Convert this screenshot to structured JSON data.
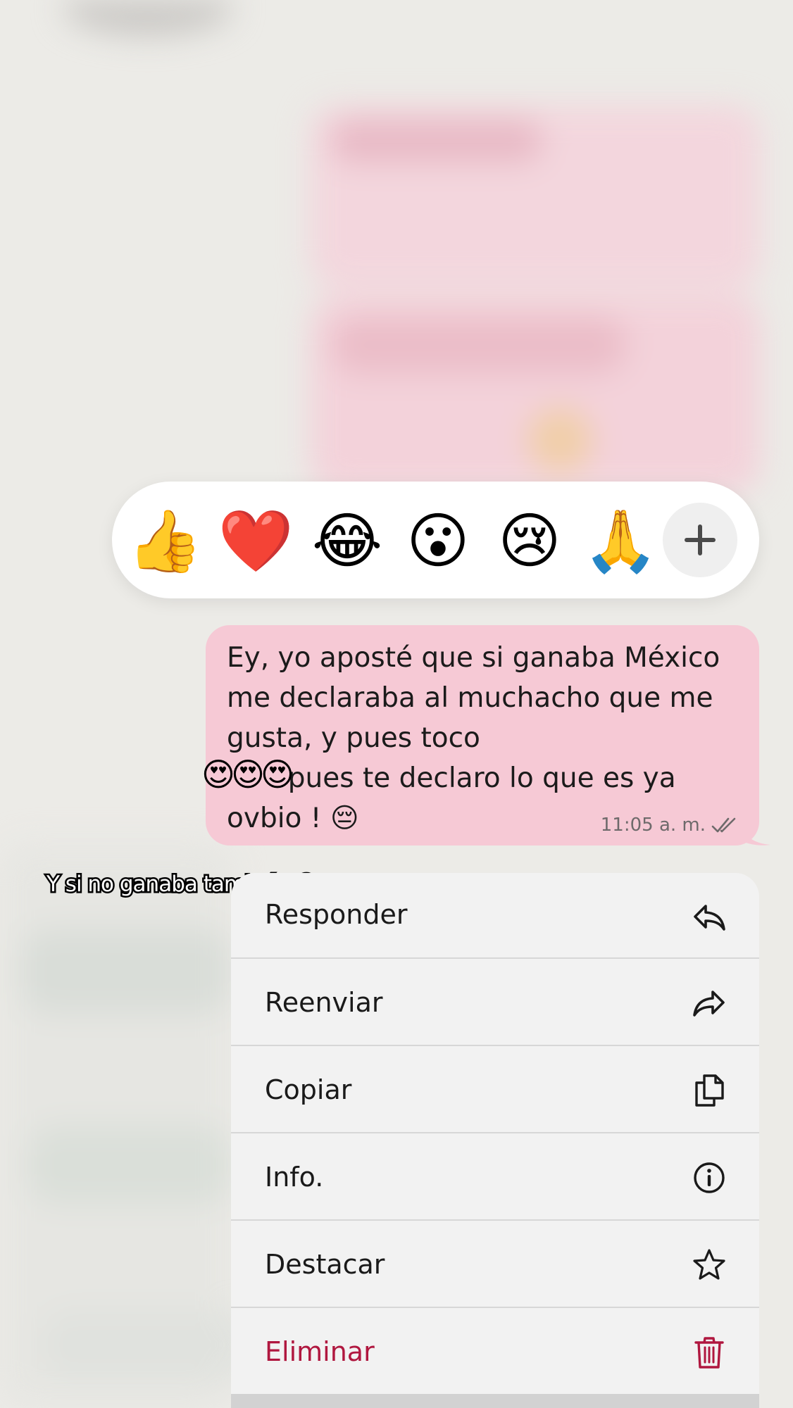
{
  "reactions": {
    "items": [
      "👍",
      "❤️",
      "😂",
      "😮",
      "😢",
      "🙏"
    ],
    "add_label": "+"
  },
  "message": {
    "text": "Ey, yo aposté que si ganaba México\nme declaraba al muchacho que me\ngusta, y pues toco\n       pues te declaro lo que es ya\novbio ! 😔",
    "emoji_overlay": "😍😍😍",
    "time": "11:05 a. m.",
    "status_icon": "double-check-icon",
    "bubble_color": "#f6c9d5"
  },
  "caption": {
    "text": "Y si no ganaba también 😙"
  },
  "menu": {
    "items": [
      {
        "label": "Responder",
        "icon": "reply-icon"
      },
      {
        "label": "Reenviar",
        "icon": "forward-icon"
      },
      {
        "label": "Copiar",
        "icon": "copy-icon"
      },
      {
        "label": "Info.",
        "icon": "info-icon"
      },
      {
        "label": "Destacar",
        "icon": "star-icon"
      },
      {
        "label": "Eliminar",
        "icon": "trash-icon",
        "color": "#b0173f"
      }
    ]
  }
}
